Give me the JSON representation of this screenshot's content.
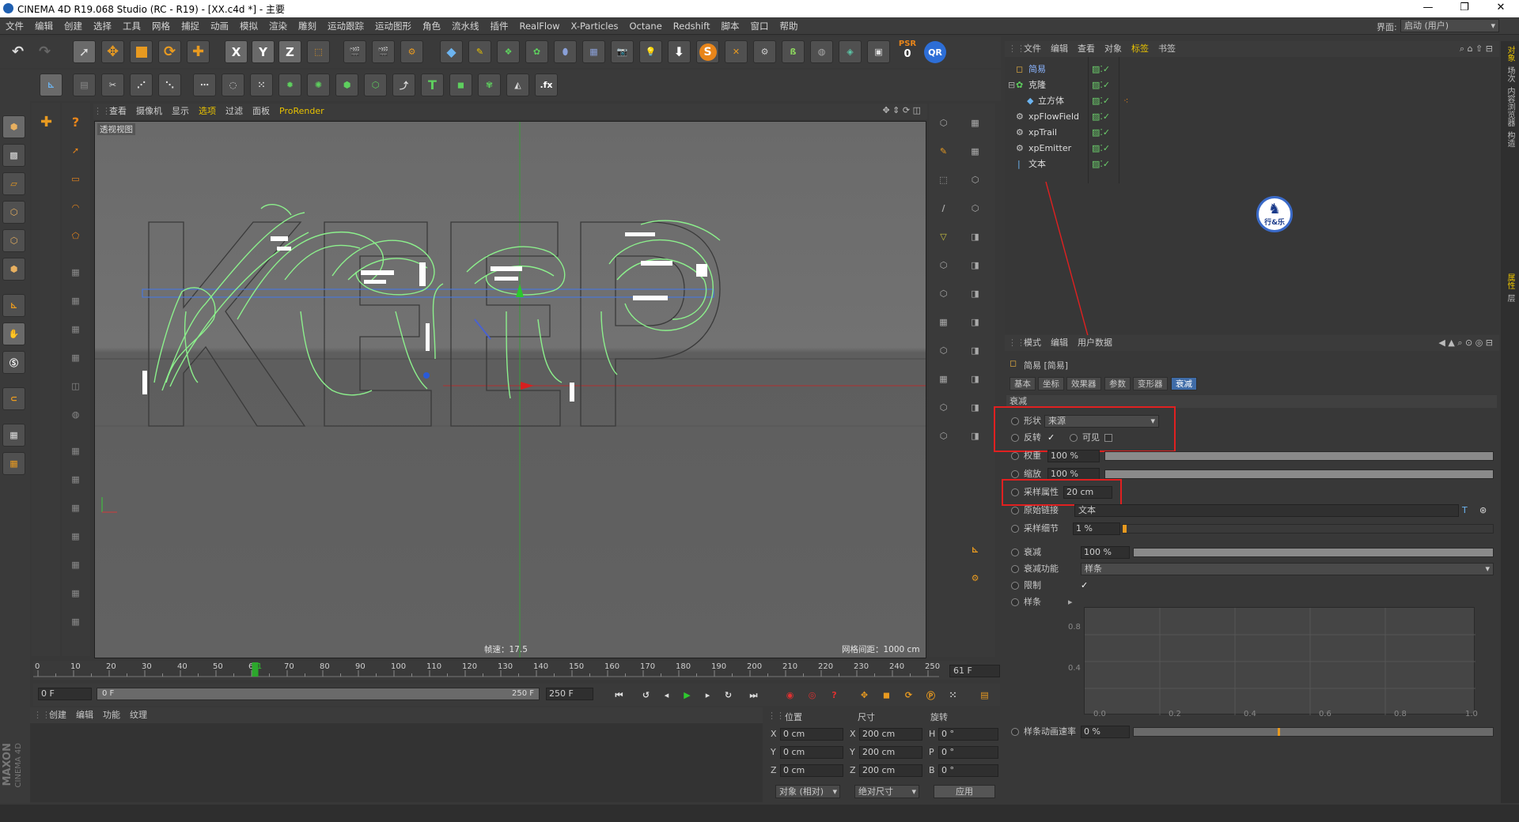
{
  "window": {
    "title": "CINEMA 4D R19.068 Studio (RC - R19) - [XX.c4d *] - 主要",
    "min_glyph": "—",
    "max_glyph": "❐",
    "close_glyph": "✕"
  },
  "menu": [
    "文件",
    "编辑",
    "创建",
    "选择",
    "工具",
    "网格",
    "捕捉",
    "动画",
    "模拟",
    "渲染",
    "雕刻",
    "运动跟踪",
    "运动图形",
    "角色",
    "流水线",
    "插件",
    "RealFlow",
    "X-Particles",
    "Octane",
    "Redshift",
    "脚本",
    "窗口",
    "帮助"
  ],
  "layout": {
    "label": "界面:",
    "value": "启动 (用户)"
  },
  "toolbar": {
    "axis_x": "X",
    "axis_y": "Y",
    "axis_z": "Z",
    "psr_label": "PSR",
    "psr_value": "0",
    "qr_label": "QR",
    "s_label": "S",
    "text_tool": "T",
    "fx_label": ".fx"
  },
  "viewport": {
    "menu": [
      "查看",
      "摄像机",
      "显示",
      "选项",
      "过滤",
      "面板",
      "ProRender"
    ],
    "selected_menu": "选项",
    "label": "透视视图",
    "fps": "帧速：17.5",
    "grid_spacing": "网格间距：1000 cm",
    "scene_text": "KEEP"
  },
  "timeline": {
    "ticks": [
      "0",
      "10",
      "20",
      "30",
      "40",
      "50",
      "60",
      "61",
      "70",
      "80",
      "90",
      "100",
      "110",
      "120",
      "130",
      "140",
      "150",
      "160",
      "170",
      "180",
      "190",
      "200",
      "210",
      "220",
      "230",
      "240",
      "250"
    ],
    "current_frame": "61 F",
    "current_frame_value": 61,
    "start_field": "0 F",
    "range_start": "0 F",
    "range_end": "250 F",
    "end_field": "250 F"
  },
  "materials": {
    "menu": [
      "创建",
      "编辑",
      "功能",
      "纹理"
    ],
    "brand_top": "MAXON",
    "brand_bottom": "CINEMA 4D"
  },
  "coords": {
    "headers": [
      "位置",
      "尺寸",
      "旋转"
    ],
    "rows": [
      {
        "a": "X",
        "pos": "0 cm",
        "b": "X",
        "size": "200 cm",
        "c": "H",
        "rot": "0 °"
      },
      {
        "a": "Y",
        "pos": "0 cm",
        "b": "Y",
        "size": "200 cm",
        "c": "P",
        "rot": "0 °"
      },
      {
        "a": "Z",
        "pos": "0 cm",
        "b": "Z",
        "size": "200 cm",
        "c": "B",
        "rot": "0 °"
      }
    ],
    "mode_object": "对象 (相对)",
    "mode_size": "绝对尺寸",
    "apply": "应用"
  },
  "object_manager": {
    "menu": [
      "文件",
      "编辑",
      "查看",
      "对象",
      "标签",
      "书签"
    ],
    "objects": [
      {
        "name": "简易",
        "indent": 0,
        "icon": "simple-effector-icon"
      },
      {
        "name": "克隆",
        "indent": 0,
        "icon": "cloner-icon"
      },
      {
        "name": "立方体",
        "indent": 1,
        "icon": "cube-icon"
      },
      {
        "name": "xpFlowField",
        "indent": 0,
        "icon": "xp-icon"
      },
      {
        "name": "xpTrail",
        "indent": 0,
        "icon": "xp-icon"
      },
      {
        "name": "xpEmitter",
        "indent": 0,
        "icon": "xp-icon"
      },
      {
        "name": "文本",
        "indent": 0,
        "icon": "text-icon"
      }
    ],
    "logo_text": "行&乐"
  },
  "attribute_manager": {
    "menu": [
      "模式",
      "编辑",
      "用户数据"
    ],
    "object_title": "简易 [简易]",
    "tabs": [
      "基本",
      "坐标",
      "效果器",
      "参数",
      "变形器",
      "衰减"
    ],
    "active_tab": "衰减",
    "section": "衰减",
    "props": {
      "shape_label": "形状",
      "shape_value": "来源",
      "invert_label": "反转",
      "invert_check": "✓",
      "visible_label": "可见",
      "weight_label": "权重",
      "weight_value": "100 %",
      "weight": 100,
      "scale_label": "缩放",
      "scale_value": "100 %",
      "scale": 100,
      "sample_label": "采样属性",
      "sample_value": "20 cm",
      "origin_label": "原始链接",
      "origin_value": "文本",
      "detail_label": "采样细节",
      "detail_value": "1 %",
      "detail": 1,
      "falloff_label": "衰减",
      "falloff_value": "100 %",
      "falloff": 100,
      "func_label": "衰减功能",
      "func_value": "样条",
      "limit_label": "限制",
      "limit_check": "✓",
      "spline_label": "样条",
      "spline_speed_label": "样条动画速率",
      "spline_speed_value": "0 %",
      "spline_speed": 0
    },
    "graph": {
      "y_labels": [
        "0.8",
        "0.4"
      ],
      "x_labels": [
        "0.0",
        "0.2",
        "0.4",
        "0.6",
        "0.8",
        "1.0"
      ]
    }
  },
  "right_strip": [
    "对象",
    "场次",
    "内容浏览器",
    "构造",
    "属性",
    "层"
  ],
  "colors": {
    "accent": "#e8c200",
    "highlight": "#e02020",
    "particles": "#8cf08c",
    "tab_active": "#3f6ca8"
  }
}
